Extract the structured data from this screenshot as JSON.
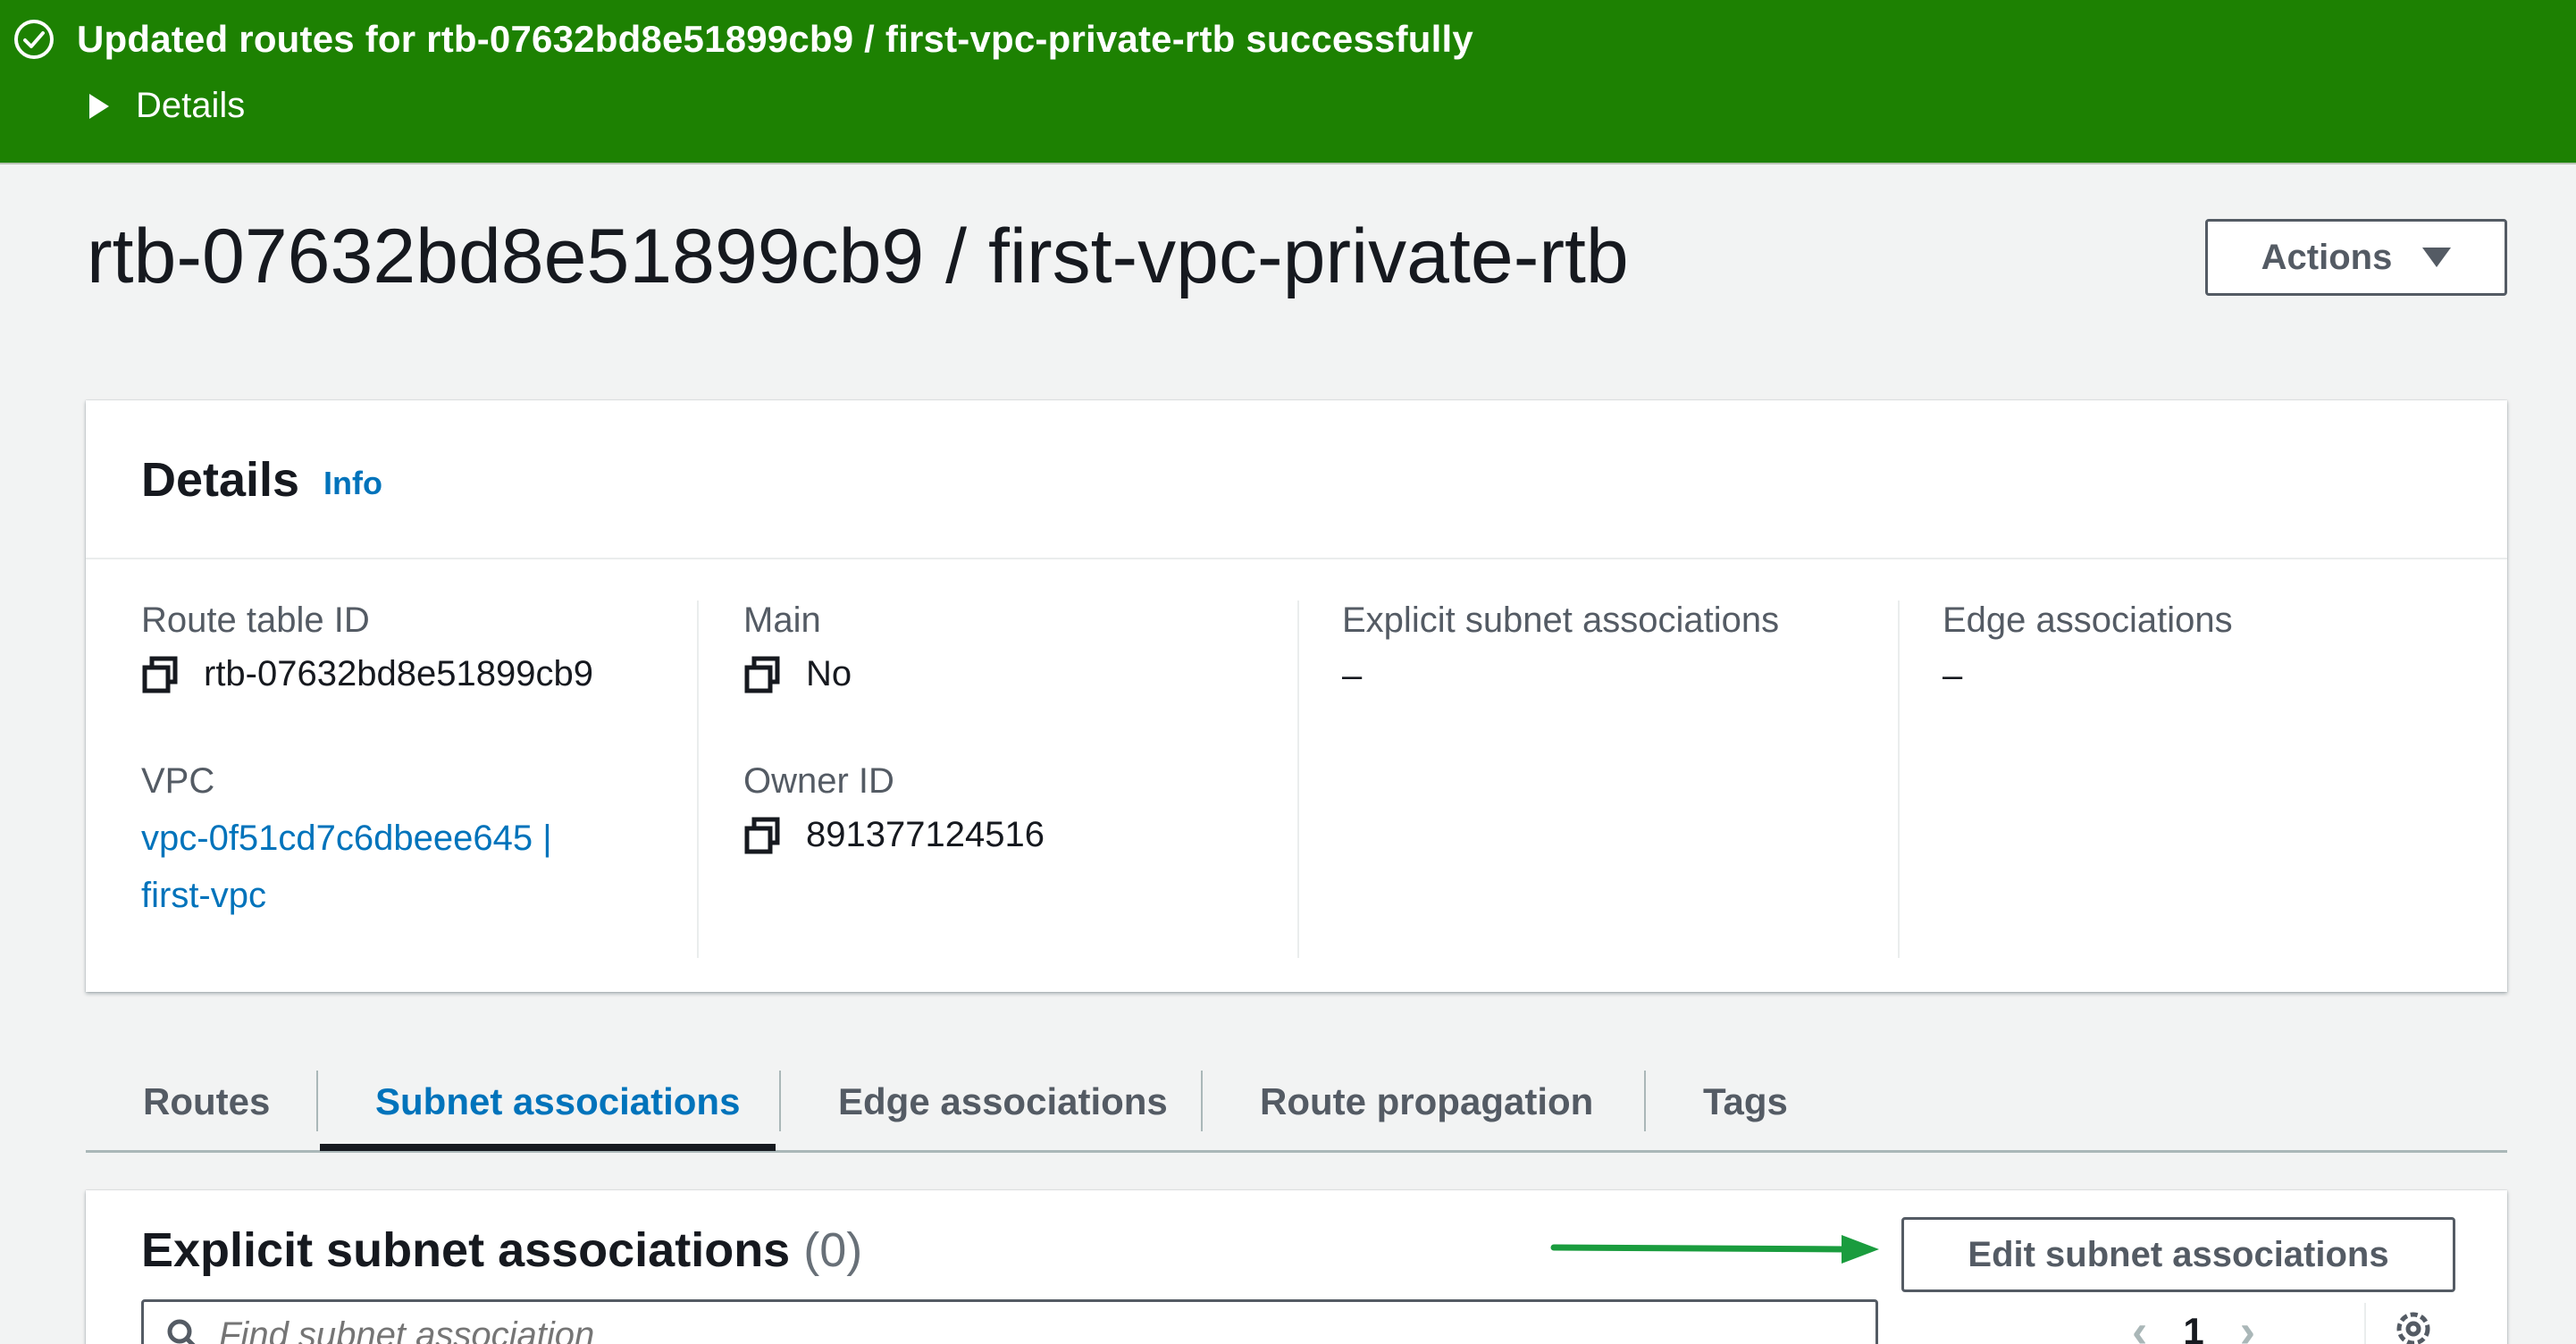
{
  "flash": {
    "message": "Updated routes for rtb-07632bd8e51899cb9 / first-vpc-private-rtb successfully",
    "details_label": "Details",
    "color": "#1d8102"
  },
  "header": {
    "title": "rtb-07632bd8e51899cb9 / first-vpc-private-rtb",
    "actions_label": "Actions"
  },
  "details": {
    "title": "Details",
    "info_label": "Info",
    "route_table_id_label": "Route table ID",
    "route_table_id_value": "rtb-07632bd8e51899cb9",
    "vpc_label": "VPC",
    "vpc_value_line1": "vpc-0f51cd7c6dbeee645 |",
    "vpc_value_line2": "first-vpc",
    "main_label": "Main",
    "main_value": "No",
    "owner_id_label": "Owner ID",
    "owner_id_value": "891377124516",
    "explicit_label": "Explicit subnet associations",
    "explicit_value": "–",
    "edge_label": "Edge associations",
    "edge_value": "–"
  },
  "tabs": [
    {
      "label": "Routes",
      "active": false
    },
    {
      "label": "Subnet associations",
      "active": true
    },
    {
      "label": "Edge associations",
      "active": false
    },
    {
      "label": "Route propagation",
      "active": false
    },
    {
      "label": "Tags",
      "active": false
    }
  ],
  "subnet_panel": {
    "title": "Explicit subnet associations",
    "count": "(0)",
    "edit_label": "Edit subnet associations",
    "search_placeholder": "Find subnet association",
    "page": "1",
    "arrow_color": "#1a9c3e"
  },
  "colors": {
    "link": "#0073bb",
    "text": "#16191f",
    "background": "#f2f3f3"
  }
}
